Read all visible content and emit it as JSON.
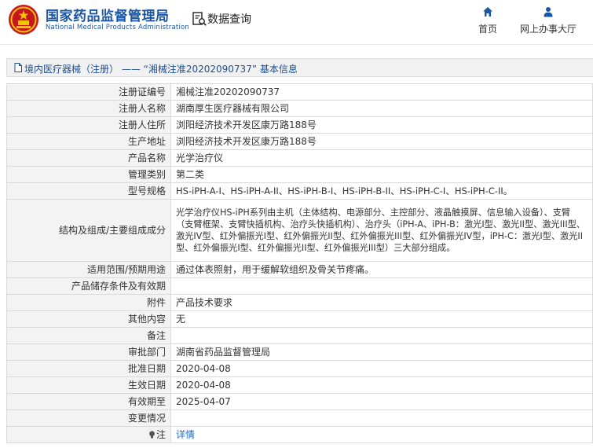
{
  "header": {
    "brand_cn": "国家药品监督管理局",
    "brand_en": "National Medical Products Administration",
    "query_label": "数据查询",
    "nav": {
      "home": "首页",
      "hall": "网上办事大厅"
    }
  },
  "breadcrumb": {
    "title": "境内医疗器械（注册） —— “湘械注准20202090737” 基本信息"
  },
  "rows": [
    {
      "label": "注册证编号",
      "value": "湘械注准20202090737"
    },
    {
      "label": "注册人名称",
      "value": "湖南厚生医疗器械有限公司"
    },
    {
      "label": "注册人住所",
      "value": "浏阳经济技术开发区康万路188号"
    },
    {
      "label": "生产地址",
      "value": "浏阳经济技术开发区康万路188号"
    },
    {
      "label": "产品名称",
      "value": "光学治疗仪"
    },
    {
      "label": "管理类别",
      "value": "第二类"
    },
    {
      "label": "型号规格",
      "value": "HS-iPH-A-I、HS-iPH-A-II、HS-iPH-B-I、HS-iPH-B-II、HS-iPH-C-I、HS-iPH-C-II。"
    },
    {
      "label": "结构及组成/主要组成成分",
      "value": "光学治疗仪HS-iPH系列由主机（主体结构、电源部分、主控部分、液晶触摸屏、信息输入设备）、支臂（支臂框架、支臂快插机构、治疗头快插机构）、治疗头（iPH-A、iPH-B：激光I型、激光II型、激光III型、激光IV型、红外偏振光I型、红外偏振光II型、红外偏振光III型、红外偏振光IV型，iPH-C：激光I型、激光II型、红外偏振光I型、红外偏振光II型、红外偏振光III型）三大部分组成。"
    },
    {
      "label": "适用范围/预期用途",
      "value": "通过体表照射，用于缓解软组织及骨关节疼痛。"
    },
    {
      "label": "产品储存条件及有效期",
      "value": ""
    },
    {
      "label": "附件",
      "value": "产品技术要求"
    },
    {
      "label": "其他内容",
      "value": "无"
    },
    {
      "label": "备注",
      "value": ""
    },
    {
      "label": "审批部门",
      "value": "湖南省药品监督管理局"
    },
    {
      "label": "批准日期",
      "value": "2020-04-08"
    },
    {
      "label": "生效日期",
      "value": "2020-04-08"
    },
    {
      "label": "有效期至",
      "value": "2025-04-07"
    },
    {
      "label": "变更情况",
      "value": ""
    },
    {
      "label": "注",
      "value": "详情"
    }
  ],
  "colors": {
    "brand_blue": "#1b56a4",
    "link_blue": "#1b6fc4",
    "label_bg": "#f3f3f3",
    "titlebar_bg": "#f1f1f1",
    "emblem_red": "#c8161d",
    "emblem_gold": "#f5c400"
  },
  "icons": {
    "logo": "national-emblem-icon",
    "query": "document-search-icon",
    "home": "home-icon",
    "hall": "user-icon",
    "title": "document-icon",
    "note": "lightbulb-icon"
  }
}
